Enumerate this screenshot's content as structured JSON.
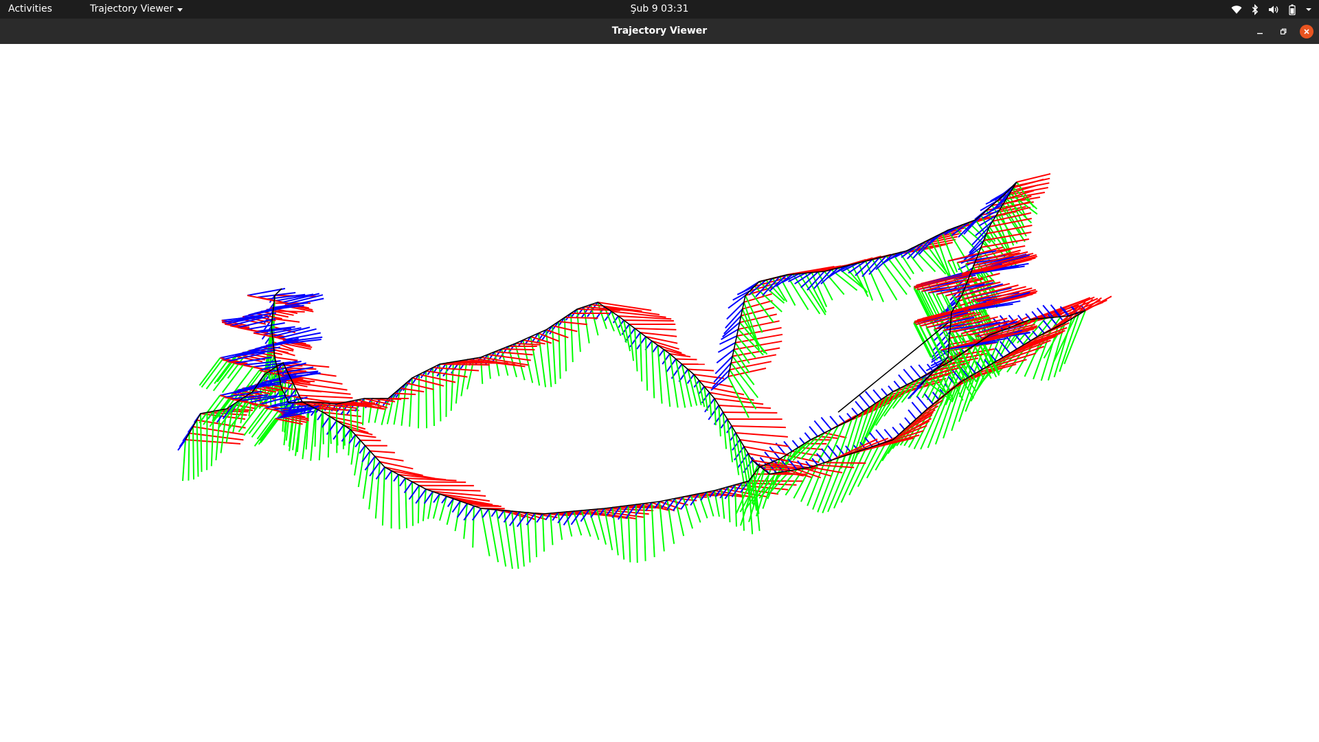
{
  "topbar": {
    "activities": "Activities",
    "app_menu": "Trajectory Viewer",
    "clock": "Şub 9  03:31",
    "tray_icons": [
      "wifi-icon",
      "bluetooth-icon",
      "volume-icon",
      "battery-icon",
      "system-menu-chevron-icon"
    ]
  },
  "window": {
    "title": "Trajectory Viewer",
    "controls": [
      "minimize",
      "restore",
      "close"
    ]
  },
  "viewer": {
    "axis_colors": {
      "x": "#ff0000",
      "y": "#00ff00",
      "z": "#0000ff",
      "path": "#000000"
    },
    "background": "#ffffff"
  }
}
